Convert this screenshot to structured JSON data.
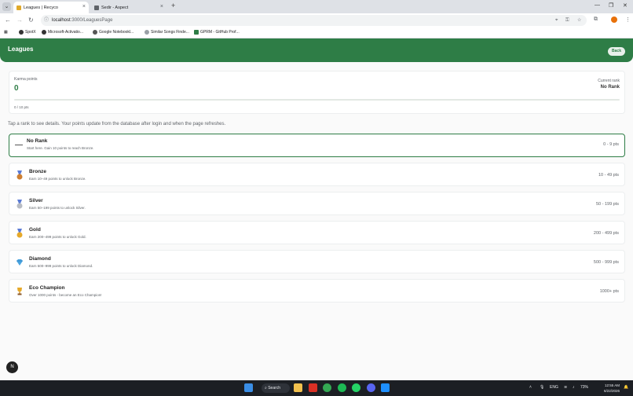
{
  "browser": {
    "tabs": [
      {
        "title": "Leagues | Recyco",
        "active": true
      },
      {
        "title": "Sedir - Aspect",
        "active": false
      }
    ],
    "url": {
      "host": "localhost",
      "path": ":3000/LeaguesPage"
    },
    "bookmarks": [
      "SpotX",
      "Microsoft-Activatio...",
      "Google Notebookl...",
      "Similar Songs Finde...",
      "GPRM - GitHub Prof..."
    ]
  },
  "header": {
    "title": "Leagues",
    "back_label": "Back",
    "accent": "#2e7d46"
  },
  "karma": {
    "label": "Karma points",
    "value": "0",
    "current_rank_label": "Current rank",
    "current_rank_value": "No Rank",
    "progress_text": "0 / 10 pts",
    "progress_fraction": 0
  },
  "hint": "Tap a rank to see details. Your points update from the database after login and when the page refreshes.",
  "ranks": [
    {
      "name": "No Rank",
      "desc": "Start here. Gain 10 points to reach Bronze.",
      "pts": "0 - 9 pts",
      "icon": "dash-icon"
    },
    {
      "name": "Bronze",
      "desc": "Earn 10–49 points to unlock Bronze.",
      "pts": "10 - 49 pts",
      "icon": "bronze-medal-icon"
    },
    {
      "name": "Silver",
      "desc": "Earn 50–199 points to unlock Silver.",
      "pts": "50 - 199 pts",
      "icon": "silver-medal-icon"
    },
    {
      "name": "Gold",
      "desc": "Earn 200–499 points to unlock Gold.",
      "pts": "200 - 499 pts",
      "icon": "gold-medal-icon"
    },
    {
      "name": "Diamond",
      "desc": "Earn 500–999 points to unlock Diamond.",
      "pts": "500 - 999 pts",
      "icon": "diamond-icon"
    },
    {
      "name": "Eco Champion",
      "desc": "Over 1000 points - become an Eco Champion!",
      "pts": "1000+ pts",
      "icon": "trophy-icon"
    }
  ],
  "fab_label": "N",
  "taskbar": {
    "search_label": "Search",
    "lang": "ENG",
    "battery": "73%",
    "time": "12:55 AM",
    "date": "6/22/2026"
  }
}
